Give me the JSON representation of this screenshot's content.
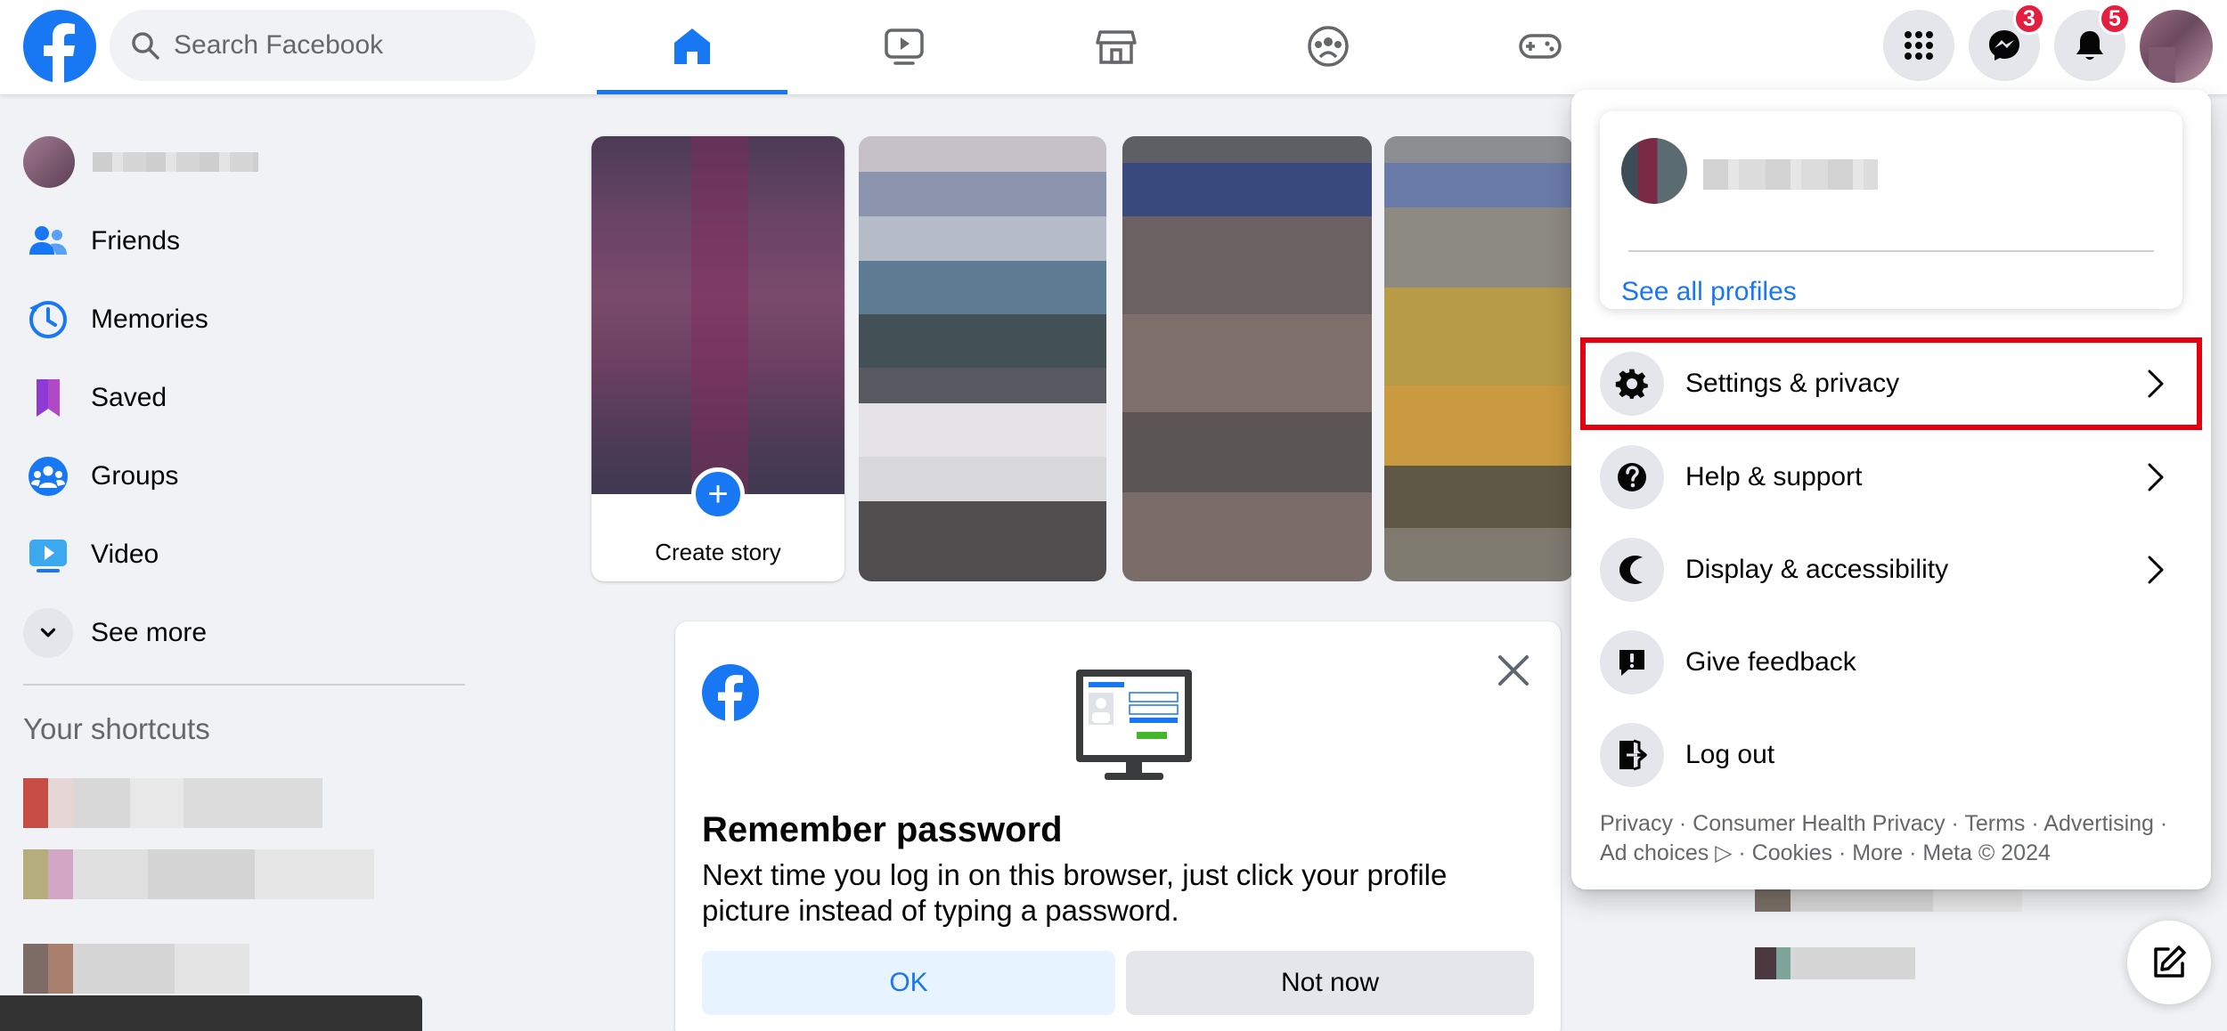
{
  "search": {
    "placeholder": "Search Facebook"
  },
  "badges": {
    "messenger": "3",
    "notifications": "5"
  },
  "sidebar": {
    "items": [
      {
        "label": "Friends"
      },
      {
        "label": "Memories"
      },
      {
        "label": "Saved"
      },
      {
        "label": "Groups"
      },
      {
        "label": "Video"
      },
      {
        "label": "See more"
      }
    ],
    "shortcuts_title": "Your shortcuts"
  },
  "stories": {
    "create_label": "Create story"
  },
  "remember": {
    "title": "Remember password",
    "description": "Next time you log in on this browser, just click your profile picture instead of typing a password.",
    "ok_label": "OK",
    "not_now_label": "Not now"
  },
  "menu": {
    "see_all_profiles": "See all profiles",
    "items": [
      {
        "label": "Settings & privacy",
        "icon": "gear-icon",
        "has_chevron": true,
        "highlighted": true
      },
      {
        "label": "Help & support",
        "icon": "question-icon",
        "has_chevron": true
      },
      {
        "label": "Display & accessibility",
        "icon": "moon-icon",
        "has_chevron": true
      },
      {
        "label": "Give feedback",
        "icon": "feedback-icon",
        "has_chevron": false
      },
      {
        "label": "Log out",
        "icon": "logout-icon",
        "has_chevron": false
      }
    ],
    "footer": {
      "line1": "Privacy · Consumer Health Privacy · Terms · Advertising ·",
      "line2": "Ad choices ▷ · Cookies · More · Meta © 2024"
    }
  },
  "colors": {
    "brand": "#1877f2",
    "highlight": "#e4000f",
    "badge": "#e41e3f"
  }
}
